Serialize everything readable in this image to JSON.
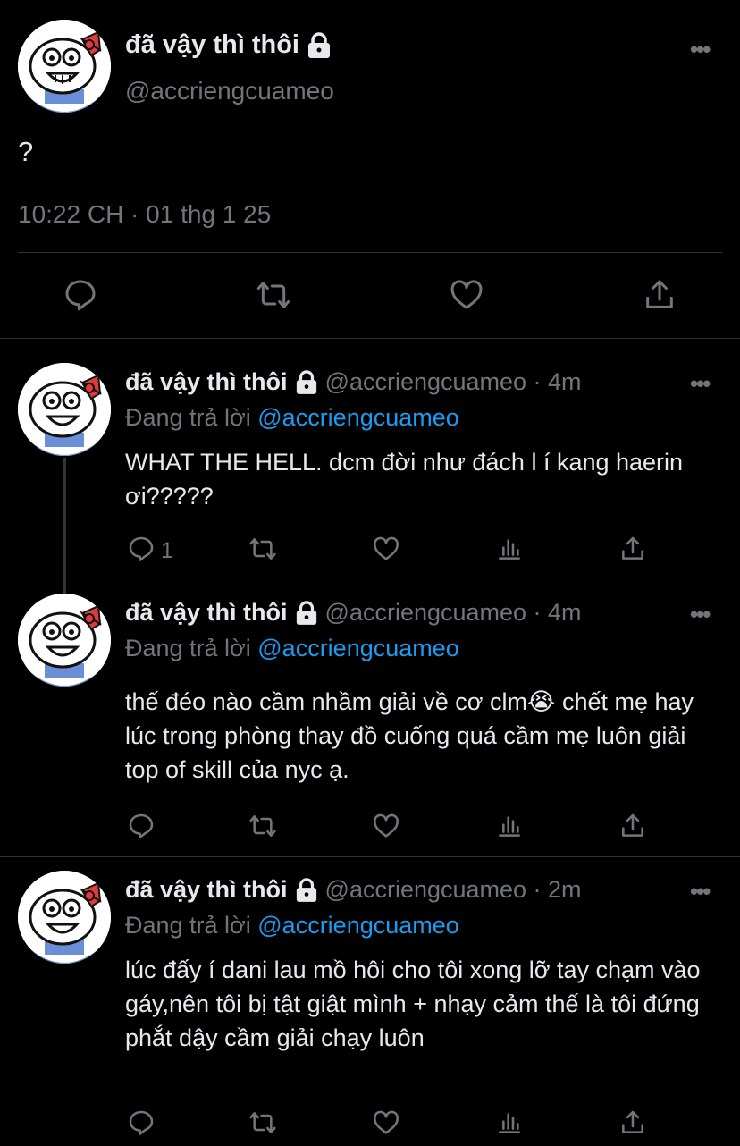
{
  "main_tweet": {
    "display_name": "đã vậy thì thôi",
    "handle": "@accriengcuameo",
    "text": "?",
    "timestamp": "10:22 CH · 01 thg 1 25",
    "more_icon": "more-horizontal-icon",
    "protected_icon": "lock-icon",
    "actions": [
      "reply-icon",
      "retweet-icon",
      "like-icon",
      "share-icon"
    ]
  },
  "replies": [
    {
      "display_name": "đã vậy thì thôi",
      "handle_time": "@accriengcuameo · 4m",
      "replying_prefix": "Đang trả lời ",
      "replying_to": "@accriengcuameo",
      "text": "WHAT THE HELL. dcm đời như đách l í kang haerin ơi?????",
      "reply_count": "1"
    },
    {
      "display_name": "đã vậy thì thôi",
      "handle_time": "@accriengcuameo · 4m",
      "replying_prefix": "Đang trả lời ",
      "replying_to": "@accriengcuameo",
      "text": "thế đéo nào cầm nhầm giải về cơ clm😭 chết mẹ hay lúc trong phòng thay đồ cuống quá cầm mẹ luôn giải top of skill của nyc ạ.",
      "reply_count": ""
    },
    {
      "display_name": "đã vậy thì thôi",
      "handle_time": "@accriengcuameo · 2m",
      "replying_prefix": "Đang trả lời ",
      "replying_to": "@accriengcuameo",
      "text": "lúc đấy í dani lau mồ hôi cho tôi xong lỡ tay chạm vào gáy,nên tôi bị tật giật mình + nhạy cảm thế là tôi đứng phắt dậy cầm giải chạy luôn",
      "reply_count": ""
    }
  ],
  "colors": {
    "background": "#000000",
    "text_primary": "#e7e9ea",
    "text_secondary": "#71767b",
    "link": "#1d9bf0",
    "divider": "#2f3336"
  }
}
